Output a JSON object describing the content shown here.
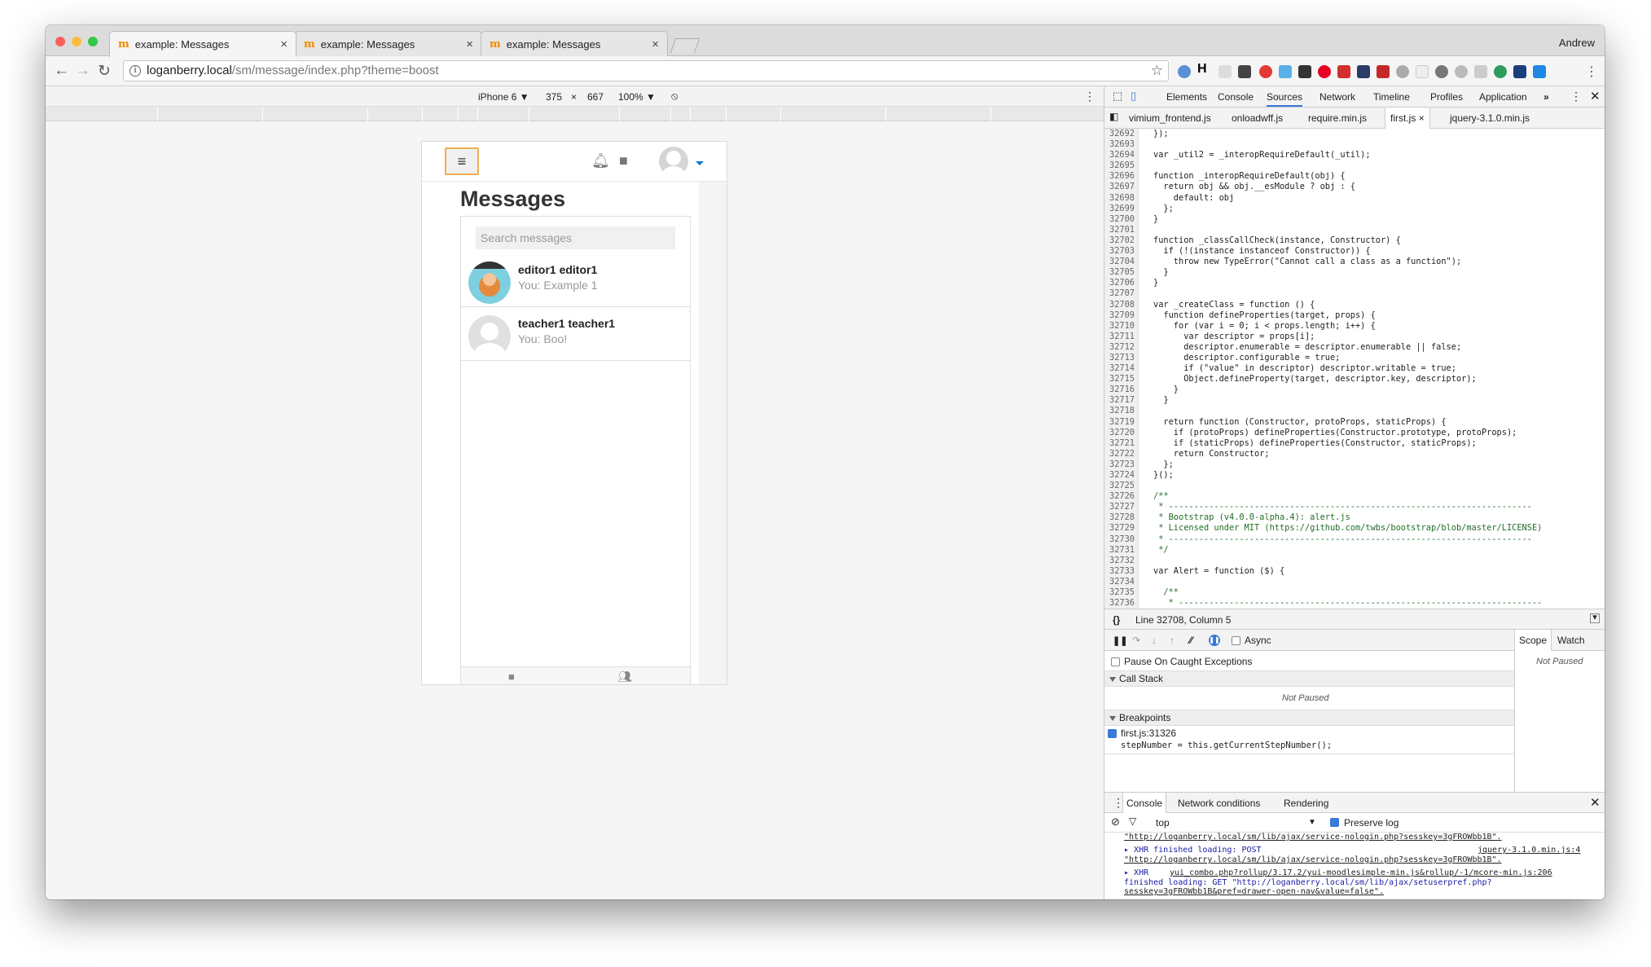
{
  "browser": {
    "tabs": [
      {
        "title": "example: Messages",
        "close": "×"
      },
      {
        "title": "example: Messages",
        "close": "×"
      },
      {
        "title": "example: Messages",
        "close": "×"
      }
    ],
    "favicon_glyph": "m",
    "user": "Andrew",
    "url_host": "loganberry.local",
    "url_path": "/sm/message/index.php?theme=boost"
  },
  "emulation": {
    "device": "iPhone 6 ▼",
    "width": "375",
    "times": "×",
    "height": "667",
    "zoom": "100% ▼"
  },
  "page": {
    "title": "Messages",
    "search_placeholder": "Search messages",
    "conversations": [
      {
        "name": "editor1 editor1",
        "message": "You: Example 1"
      },
      {
        "name": "teacher1 teacher1",
        "message": "You: Boo!"
      }
    ]
  },
  "devtools": {
    "tabs": [
      "Elements",
      "Console",
      "Sources",
      "Network",
      "Timeline",
      "Profiles",
      "Application"
    ],
    "more": "»",
    "files": [
      "vimium_frontend.js",
      "onloadwff.js",
      "require.min.js",
      "first.js",
      "jquery-3.1.0.min.js"
    ],
    "file_close": "×",
    "code_lines": [
      {
        "n": "32692",
        "t": "});"
      },
      {
        "n": "32693",
        "t": ""
      },
      {
        "n": "32694",
        "t": "var _util2 = _interopRequireDefault(_util);"
      },
      {
        "n": "32695",
        "t": ""
      },
      {
        "n": "32696",
        "t": "function _interopRequireDefault(obj) {"
      },
      {
        "n": "32697",
        "t": "  return obj && obj.__esModule ? obj : {"
      },
      {
        "n": "32698",
        "t": "    default: obj"
      },
      {
        "n": "32699",
        "t": "  };"
      },
      {
        "n": "32700",
        "t": "}"
      },
      {
        "n": "32701",
        "t": ""
      },
      {
        "n": "32702",
        "t": "function _classCallCheck(instance, Constructor) {"
      },
      {
        "n": "32703",
        "t": "  if (!(instance instanceof Constructor)) {"
      },
      {
        "n": "32704",
        "t": "    throw new TypeError(\"Cannot call a class as a function\");"
      },
      {
        "n": "32705",
        "t": "  }"
      },
      {
        "n": "32706",
        "t": "}"
      },
      {
        "n": "32707",
        "t": ""
      },
      {
        "n": "32708",
        "t": "var _createClass = function () {"
      },
      {
        "n": "32709",
        "t": "  function defineProperties(target, props) {"
      },
      {
        "n": "32710",
        "t": "    for (var i = 0; i < props.length; i++) {"
      },
      {
        "n": "32711",
        "t": "      var descriptor = props[i];"
      },
      {
        "n": "32712",
        "t": "      descriptor.enumerable = descriptor.enumerable || false;"
      },
      {
        "n": "32713",
        "t": "      descriptor.configurable = true;"
      },
      {
        "n": "32714",
        "t": "      if (\"value\" in descriptor) descriptor.writable = true;"
      },
      {
        "n": "32715",
        "t": "      Object.defineProperty(target, descriptor.key, descriptor);"
      },
      {
        "n": "32716",
        "t": "    }"
      },
      {
        "n": "32717",
        "t": "  }"
      },
      {
        "n": "32718",
        "t": ""
      },
      {
        "n": "32719",
        "t": "  return function (Constructor, protoProps, staticProps) {"
      },
      {
        "n": "32720",
        "t": "    if (protoProps) defineProperties(Constructor.prototype, protoProps);"
      },
      {
        "n": "32721",
        "t": "    if (staticProps) defineProperties(Constructor, staticProps);"
      },
      {
        "n": "32722",
        "t": "    return Constructor;"
      },
      {
        "n": "32723",
        "t": "  };"
      },
      {
        "n": "32724",
        "t": "}();"
      },
      {
        "n": "32725",
        "t": ""
      },
      {
        "n": "32726",
        "t": "/**"
      },
      {
        "n": "32727",
        "t": " * ------------------------------------------------------------------------"
      },
      {
        "n": "32728",
        "t": " * Bootstrap (v4.0.0-alpha.4): alert.js"
      },
      {
        "n": "32729",
        "t": " * Licensed under MIT (https://github.com/twbs/bootstrap/blob/master/LICENSE)"
      },
      {
        "n": "32730",
        "t": " * ------------------------------------------------------------------------"
      },
      {
        "n": "32731",
        "t": " */"
      },
      {
        "n": "32732",
        "t": ""
      },
      {
        "n": "32733",
        "t": "var Alert = function ($) {"
      },
      {
        "n": "32734",
        "t": ""
      },
      {
        "n": "32735",
        "t": "  /**"
      },
      {
        "n": "32736",
        "t": "   * ------------------------------------------------------------------------"
      }
    ],
    "status": "Line 32708, Column 5",
    "braces": "{}",
    "async": "Async",
    "pause_caught": "Pause On Caught Exceptions",
    "call_stack": "Call Stack",
    "not_paused": "Not Paused",
    "breakpoints": "Breakpoints",
    "bp_file": "first.js:31326",
    "bp_code": "stepNumber = this.getCurrentStepNumber();",
    "scope": "Scope",
    "watch": "Watch",
    "scope_not_paused": "Not Paused",
    "drawer_tabs": [
      "Console",
      "Network conditions",
      "Rendering"
    ],
    "context": "top",
    "preserve": "Preserve log",
    "log": {
      "l0": "\"http://loganberry.local/sm/lib/ajax/service-nologin.php?sesskey=3gFROWbb1B\".",
      "l1a": "XHR finished loading: POST",
      "l1src": "jquery-3.1.0.min.js:4",
      "l1b": "\"http://loganberry.local/sm/lib/ajax/service-nologin.php?sesskey=3gFROWbb1B\".",
      "l2a": "XHR",
      "l2src": "yui_combo.php?rollup/3.17.2/yui-moodlesimple-min.js&rollup/-1/mcore-min.js:206",
      "l2b": "finished loading: GET \"http://loganberry.local/sm/lib/ajax/setuserpref.php?",
      "l2c": "sesskey=3gFROWbb1B&pref=drawer-open-nav&value=false\".",
      "prompt": ">"
    }
  }
}
